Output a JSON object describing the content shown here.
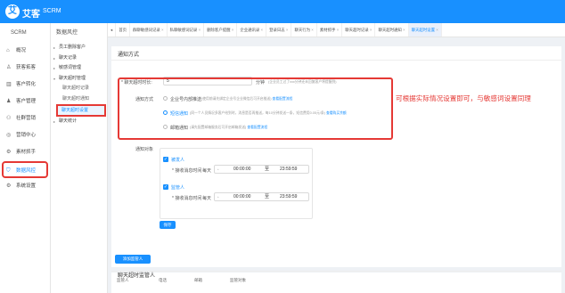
{
  "app": {
    "logo_icon": "艾",
    "brand": "艾客",
    "product": "SCRM"
  },
  "sidebar1": {
    "header": "SCRM",
    "items": [
      {
        "label": "概况",
        "icon": "home-icon",
        "glyph": "⌂"
      },
      {
        "label": "获客拓客",
        "icon": "user-add-icon",
        "glyph": "♙"
      },
      {
        "label": "客户转化",
        "icon": "chart-icon",
        "glyph": "▥"
      },
      {
        "label": "客户管理",
        "icon": "people-icon",
        "glyph": "♟"
      },
      {
        "label": "社群营销",
        "icon": "group-icon",
        "glyph": "⚇"
      },
      {
        "label": "营销中心",
        "icon": "megaphone-icon",
        "glyph": "◎"
      },
      {
        "label": "素材抓手",
        "icon": "material-icon",
        "glyph": "⚙"
      },
      {
        "label": "数据风控",
        "icon": "shield-icon",
        "glyph": "⛉"
      },
      {
        "label": "系统设置",
        "icon": "gear-icon",
        "glyph": "⚙"
      }
    ]
  },
  "sidebar2": {
    "header": "数据风控",
    "items": [
      {
        "label": "员工删除客户",
        "arrow": "▸"
      },
      {
        "label": "聊天记录",
        "arrow": "▸"
      },
      {
        "label": "敏感词管理",
        "arrow": "▸"
      },
      {
        "label": "聊天超时管理",
        "arrow": "▾"
      },
      {
        "label": "聊天超时记录",
        "arrow": ""
      },
      {
        "label": "聊天超时通知",
        "arrow": ""
      },
      {
        "label": "聊天超时设置",
        "arrow": ""
      },
      {
        "label": "聊天统计",
        "arrow": "▸"
      }
    ]
  },
  "tabs": [
    "首页",
    "群聊敏感词记录",
    "私聊敏感词记录",
    "删除客户提醒",
    "企业通讯录",
    "登录日志",
    "聊天行为",
    "素材抓手",
    "聊天超时记录",
    "聊天超时通知",
    "聊天超时设置"
  ],
  "tab_prefix": "◂",
  "tab_close": "×",
  "form": {
    "section_title": "通知方式",
    "timeout_label": "* 聊天超时时长:",
    "timeout_value": "5",
    "timeout_unit": "分钟",
    "timeout_note": "(企业员工过了xxx分钟还未回复客户将提醒到)",
    "method_label": "通知方式",
    "opt1": "企业号内部推送",
    "opt1_note": "(使用前请先绑定企业号企业微信后可开启推送)",
    "opt1_link": "查看配置流程",
    "opt2": "短信通知",
    "opt2_note": "(同一个人员情况多客户给到时，消息是否再推送，每10分钟发送一条，短信费用0.05元/条)",
    "opt2_link": "查看购买余额",
    "opt3": "邮箱通知",
    "opt3_note": "(请先配置邮箱服务后可开启邮箱发送)",
    "opt3_link": "查看配置流程",
    "annotation": "可根据实际情况设置即可，与敏感词设置同理",
    "target_label": "通知对象",
    "group1": {
      "name": "被发人",
      "time_label": "* 接收消息时间",
      "every": "每天",
      "start": "00:00:00",
      "to": "至",
      "end": "23:59:59"
    },
    "group2": {
      "name": "监管人",
      "time_label": "* 接收消息时间",
      "every": "每天",
      "start": "00:00:00",
      "to": "至",
      "end": "23:59:59"
    },
    "save_label": "保存"
  },
  "supervisor": {
    "title": "聊天超时监管人",
    "add_label": "添加监管人",
    "columns": [
      "监管人",
      "电话",
      "邮箱",
      "监管对象"
    ]
  }
}
